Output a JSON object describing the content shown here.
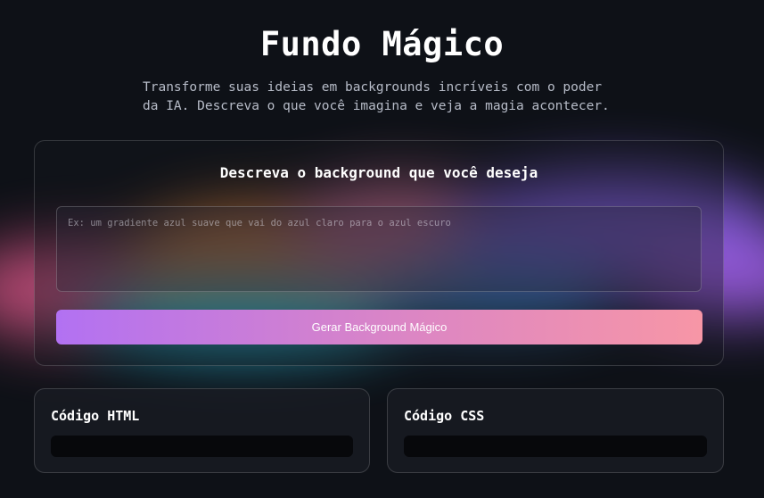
{
  "header": {
    "title": "Fundo Mágico",
    "subtitle": "Transforme suas ideias em backgrounds incríveis com o poder da IA. Descreva o que você imagina e veja a magia acontecer."
  },
  "form": {
    "title": "Descreva o background que você deseja",
    "prompt_value": "",
    "prompt_placeholder": "Ex: um gradiente azul suave que vai do azul claro para o azul escuro",
    "generate_label": "Gerar Background Mágico"
  },
  "output": {
    "html_title": "Código HTML",
    "css_title": "Código CSS",
    "html_code": "",
    "css_code": ""
  },
  "colors": {
    "background": "#0e1117",
    "button_gradient_start": "#b271f2",
    "button_gradient_end": "#f796a6"
  }
}
